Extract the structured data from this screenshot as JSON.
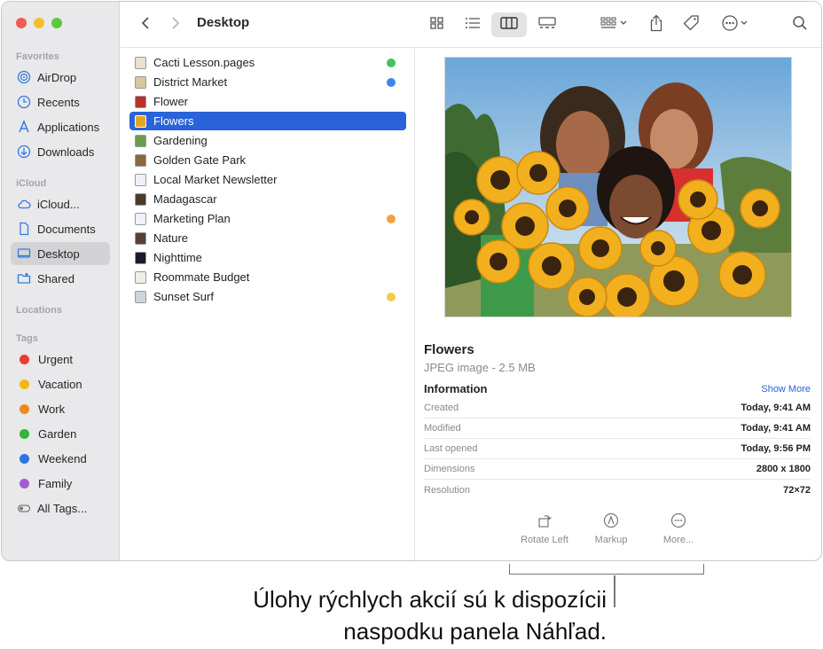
{
  "window": {
    "title": "Desktop"
  },
  "sidebar": {
    "favorites_label": "Favorites",
    "favorites": [
      {
        "label": "AirDrop",
        "icon": "airdrop-icon"
      },
      {
        "label": "Recents",
        "icon": "clock-icon"
      },
      {
        "label": "Applications",
        "icon": "applications-icon"
      },
      {
        "label": "Downloads",
        "icon": "download-icon"
      }
    ],
    "icloud_label": "iCloud",
    "icloud": [
      {
        "label": "iCloud...",
        "icon": "cloud-icon"
      },
      {
        "label": "Documents",
        "icon": "document-icon"
      },
      {
        "label": "Desktop",
        "icon": "desktop-icon",
        "selected": true
      },
      {
        "label": "Shared",
        "icon": "shared-folder-icon"
      }
    ],
    "locations_label": "Locations",
    "tags_label": "Tags",
    "tags": [
      {
        "label": "Urgent",
        "color": "#ec3b35"
      },
      {
        "label": "Vacation",
        "color": "#f2b90c"
      },
      {
        "label": "Work",
        "color": "#ee8a1b"
      },
      {
        "label": "Garden",
        "color": "#34b53c"
      },
      {
        "label": "Weekend",
        "color": "#2d73e4"
      },
      {
        "label": "Family",
        "color": "#a55bd4"
      },
      {
        "label": "All Tags...",
        "color": ""
      }
    ]
  },
  "files": [
    {
      "name": "Cacti Lesson.pages",
      "tag": "#44c25a"
    },
    {
      "name": "District Market",
      "tag": "#3f86ea"
    },
    {
      "name": "Flower",
      "tag": ""
    },
    {
      "name": "Flowers",
      "tag": "",
      "selected": true
    },
    {
      "name": "Gardening",
      "tag": ""
    },
    {
      "name": "Golden Gate Park",
      "tag": ""
    },
    {
      "name": "Local Market Newsletter",
      "tag": ""
    },
    {
      "name": "Madagascar",
      "tag": ""
    },
    {
      "name": "Marketing Plan",
      "tag": "#f0a143"
    },
    {
      "name": "Nature",
      "tag": ""
    },
    {
      "name": "Nighttime",
      "tag": ""
    },
    {
      "name": "Roommate Budget",
      "tag": ""
    },
    {
      "name": "Sunset Surf",
      "tag": "#f3cc44"
    }
  ],
  "preview": {
    "name": "Flowers",
    "kind": "JPEG image - 2.5 MB",
    "info_label": "Information",
    "show_more": "Show More",
    "info": [
      {
        "key": "Created",
        "value": "Today, 9:41 AM"
      },
      {
        "key": "Modified",
        "value": "Today, 9:41 AM"
      },
      {
        "key": "Last opened",
        "value": "Today, 9:56 PM"
      },
      {
        "key": "Dimensions",
        "value": "2800 x 1800"
      },
      {
        "key": "Resolution",
        "value": "72×72"
      }
    ],
    "actions": [
      {
        "label": "Rotate Left",
        "icon": "rotate-left-icon"
      },
      {
        "label": "Markup",
        "icon": "markup-icon"
      },
      {
        "label": "More...",
        "icon": "more-icon"
      }
    ]
  },
  "caption": {
    "line1": "Úlohy rýchlych akcií sú k dispozícii",
    "line2": "naspodku panela Náhľad."
  },
  "colors": {
    "selection": "#2a63d9",
    "traffic_red": "#ee5c55",
    "traffic_yellow": "#f5bd2f",
    "traffic_green": "#5fc63f"
  }
}
